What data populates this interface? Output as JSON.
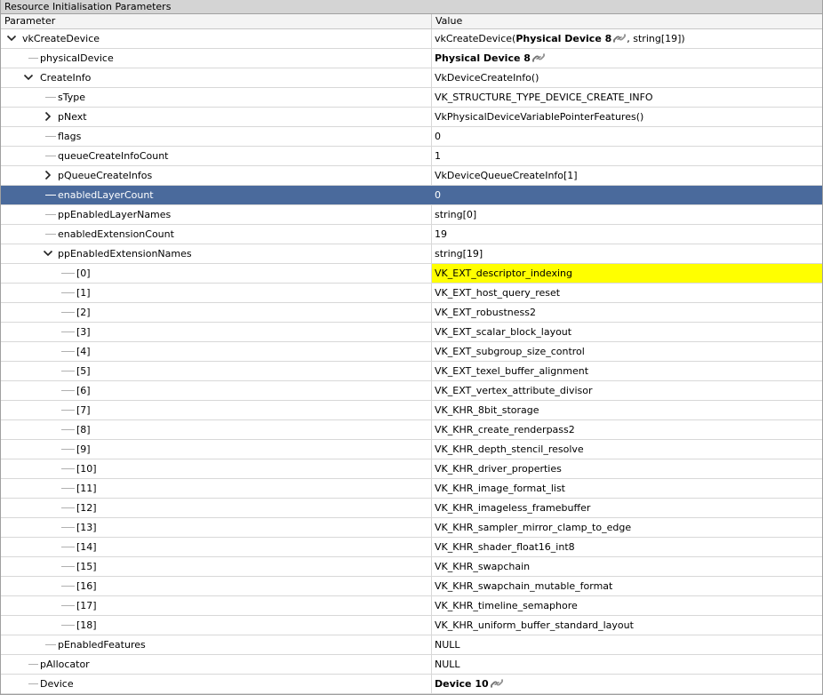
{
  "panel_title": "Resource Initialisation Parameters",
  "columns": {
    "parameter": "Parameter",
    "value": "Value"
  },
  "rows": [
    {
      "id": "vkCreateDevice",
      "param": "vkCreateDevice",
      "indent": 0,
      "expander": "expanded",
      "value_parts": [
        "vkCreateDevice(",
        "Physical Device 8",
        ", string[19])"
      ]
    },
    {
      "id": "physicalDevice",
      "param": "physicalDevice",
      "indent": 1,
      "expander": "none",
      "value_parts": [
        "Physical Device 8"
      ]
    },
    {
      "id": "CreateInfo",
      "param": "CreateInfo",
      "indent": 1,
      "expander": "expanded",
      "value": "VkDeviceCreateInfo()"
    },
    {
      "id": "sType",
      "param": "sType",
      "indent": 2,
      "expander": "none",
      "value": "VK_STRUCTURE_TYPE_DEVICE_CREATE_INFO"
    },
    {
      "id": "pNext",
      "param": "pNext",
      "indent": 2,
      "expander": "collapsed",
      "value": "VkPhysicalDeviceVariablePointerFeatures()"
    },
    {
      "id": "flags",
      "param": "flags",
      "indent": 2,
      "expander": "none",
      "value": "0"
    },
    {
      "id": "queueCreateInfoCount",
      "param": "queueCreateInfoCount",
      "indent": 2,
      "expander": "none",
      "value": "1"
    },
    {
      "id": "pQueueCreateInfos",
      "param": "pQueueCreateInfos",
      "indent": 2,
      "expander": "collapsed",
      "value": "VkDeviceQueueCreateInfo[1]"
    },
    {
      "id": "enabledLayerCount",
      "param": "enabledLayerCount",
      "indent": 2,
      "expander": "none",
      "value": "0",
      "selected": true
    },
    {
      "id": "ppEnabledLayerNames",
      "param": "ppEnabledLayerNames",
      "indent": 2,
      "expander": "none",
      "value": "string[0]"
    },
    {
      "id": "enabledExtensionCount",
      "param": "enabledExtensionCount",
      "indent": 2,
      "expander": "none",
      "value": "19"
    },
    {
      "id": "ppEnabledExtensionNames",
      "param": "ppEnabledExtensionNames",
      "indent": 2,
      "expander": "expanded",
      "value": "string[19]"
    },
    {
      "id": "ext-0",
      "param": "[0]",
      "indent": 3,
      "expander": "none",
      "value": "VK_EXT_descriptor_indexing",
      "highlight": true
    },
    {
      "id": "ext-1",
      "param": "[1]",
      "indent": 3,
      "expander": "none",
      "value": "VK_EXT_host_query_reset"
    },
    {
      "id": "ext-2",
      "param": "[2]",
      "indent": 3,
      "expander": "none",
      "value": "VK_EXT_robustness2"
    },
    {
      "id": "ext-3",
      "param": "[3]",
      "indent": 3,
      "expander": "none",
      "value": "VK_EXT_scalar_block_layout"
    },
    {
      "id": "ext-4",
      "param": "[4]",
      "indent": 3,
      "expander": "none",
      "value": "VK_EXT_subgroup_size_control"
    },
    {
      "id": "ext-5",
      "param": "[5]",
      "indent": 3,
      "expander": "none",
      "value": "VK_EXT_texel_buffer_alignment"
    },
    {
      "id": "ext-6",
      "param": "[6]",
      "indent": 3,
      "expander": "none",
      "value": "VK_EXT_vertex_attribute_divisor"
    },
    {
      "id": "ext-7",
      "param": "[7]",
      "indent": 3,
      "expander": "none",
      "value": "VK_KHR_8bit_storage"
    },
    {
      "id": "ext-8",
      "param": "[8]",
      "indent": 3,
      "expander": "none",
      "value": "VK_KHR_create_renderpass2"
    },
    {
      "id": "ext-9",
      "param": "[9]",
      "indent": 3,
      "expander": "none",
      "value": "VK_KHR_depth_stencil_resolve"
    },
    {
      "id": "ext-10",
      "param": "[10]",
      "indent": 3,
      "expander": "none",
      "value": "VK_KHR_driver_properties"
    },
    {
      "id": "ext-11",
      "param": "[11]",
      "indent": 3,
      "expander": "none",
      "value": "VK_KHR_image_format_list"
    },
    {
      "id": "ext-12",
      "param": "[12]",
      "indent": 3,
      "expander": "none",
      "value": "VK_KHR_imageless_framebuffer"
    },
    {
      "id": "ext-13",
      "param": "[13]",
      "indent": 3,
      "expander": "none",
      "value": "VK_KHR_sampler_mirror_clamp_to_edge"
    },
    {
      "id": "ext-14",
      "param": "[14]",
      "indent": 3,
      "expander": "none",
      "value": "VK_KHR_shader_float16_int8"
    },
    {
      "id": "ext-15",
      "param": "[15]",
      "indent": 3,
      "expander": "none",
      "value": "VK_KHR_swapchain"
    },
    {
      "id": "ext-16",
      "param": "[16]",
      "indent": 3,
      "expander": "none",
      "value": "VK_KHR_swapchain_mutable_format"
    },
    {
      "id": "ext-17",
      "param": "[17]",
      "indent": 3,
      "expander": "none",
      "value": "VK_KHR_timeline_semaphore"
    },
    {
      "id": "ext-18",
      "param": "[18]",
      "indent": 3,
      "expander": "none",
      "value": "VK_KHR_uniform_buffer_standard_layout"
    },
    {
      "id": "pEnabledFeatures",
      "param": "pEnabledFeatures",
      "indent": 2,
      "expander": "none",
      "value": "NULL"
    },
    {
      "id": "pAllocator",
      "param": "pAllocator",
      "indent": 1,
      "expander": "none",
      "value": "NULL"
    },
    {
      "id": "Device",
      "param": "Device",
      "indent": 1,
      "expander": "none",
      "value_parts": [
        "Device 10"
      ]
    }
  ],
  "icons": {
    "expanded": "chevron-down-icon",
    "collapsed": "chevron-right-icon",
    "resource_link": "link-icon"
  },
  "colors": {
    "selected_row": "#4a6a9c",
    "highlight": "#ffff00",
    "header_bg": "#f4f4f4",
    "title_bg": "#d4d4d4"
  }
}
